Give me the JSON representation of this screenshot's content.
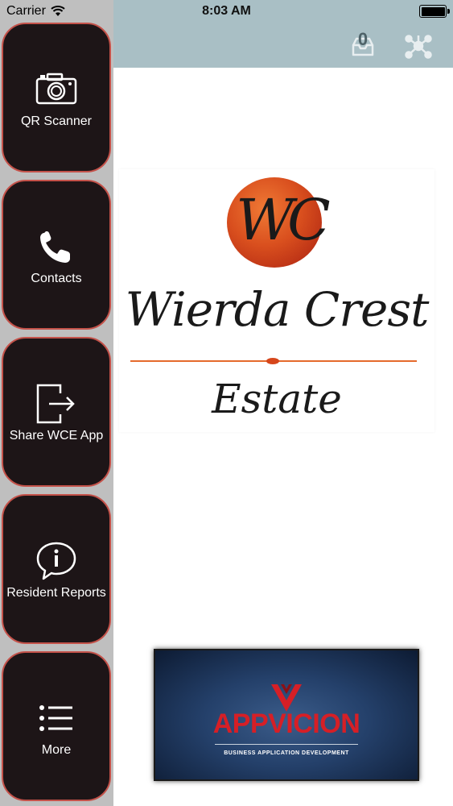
{
  "status_bar": {
    "carrier": "Carrier",
    "time": "8:03 AM"
  },
  "header": {
    "inbox_count": "0",
    "background_color": "#a9bfc5"
  },
  "sidebar": {
    "items": [
      {
        "label": "QR Scanner",
        "icon": "camera-icon"
      },
      {
        "label": "Contacts",
        "icon": "phone-icon"
      },
      {
        "label": "Share WCE App",
        "icon": "share-exit-icon"
      },
      {
        "label": "Resident Reports",
        "icon": "info-bubble-icon"
      },
      {
        "label": "More",
        "icon": "list-icon"
      }
    ],
    "item_bg_color": "#1d1517",
    "item_border_color": "#c4524a"
  },
  "logo": {
    "monogram": "WC",
    "name": "Wierda Crest",
    "sub": "Estate"
  },
  "banner": {
    "title": "APPVICION",
    "subtitle": "BUSINESS APPLICATION DEVELOPMENT"
  }
}
